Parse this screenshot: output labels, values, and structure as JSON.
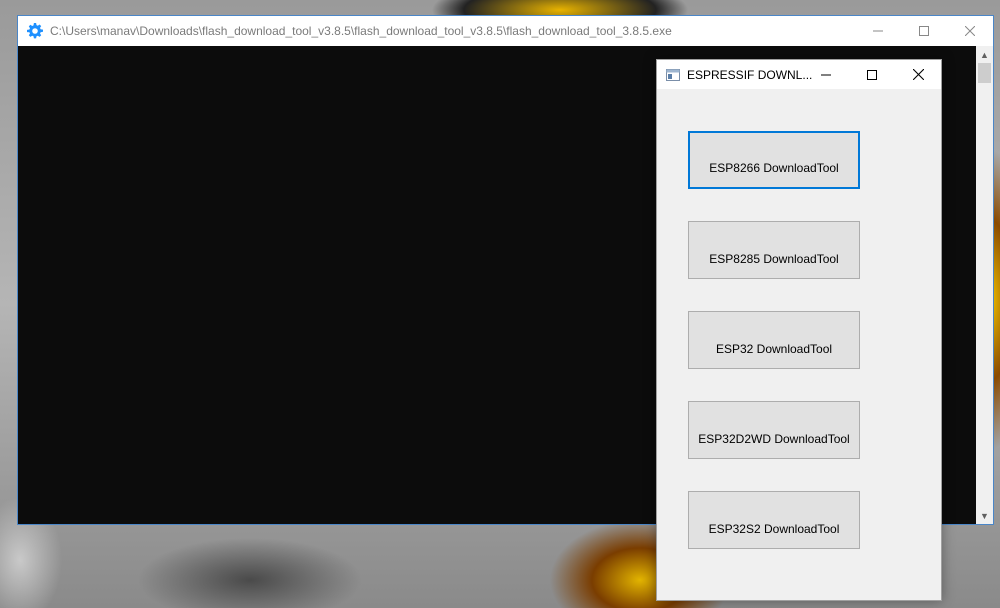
{
  "console": {
    "title": "C:\\Users\\manav\\Downloads\\flash_download_tool_v3.8.5\\flash_download_tool_v3.8.5\\flash_download_tool_3.8.5.exe",
    "icon": "gear-icon",
    "controls": {
      "minimize": "minimize-icon",
      "maximize": "maximize-icon",
      "close": "close-icon"
    }
  },
  "dialog": {
    "title": "ESPRESSIF DOWNL...",
    "buttons": [
      {
        "label": "ESP8266 DownloadTool",
        "focused": true
      },
      {
        "label": "ESP8285 DownloadTool"
      },
      {
        "label": "ESP32 DownloadTool"
      },
      {
        "label": "ESP32D2WD DownloadTool"
      },
      {
        "label": "ESP32S2 DownloadTool"
      }
    ]
  },
  "colors": {
    "accent": "#0078d7",
    "console_bg": "#0c0c0c",
    "dialog_bg": "#f0f0f0",
    "button_bg": "#e1e1e1"
  }
}
